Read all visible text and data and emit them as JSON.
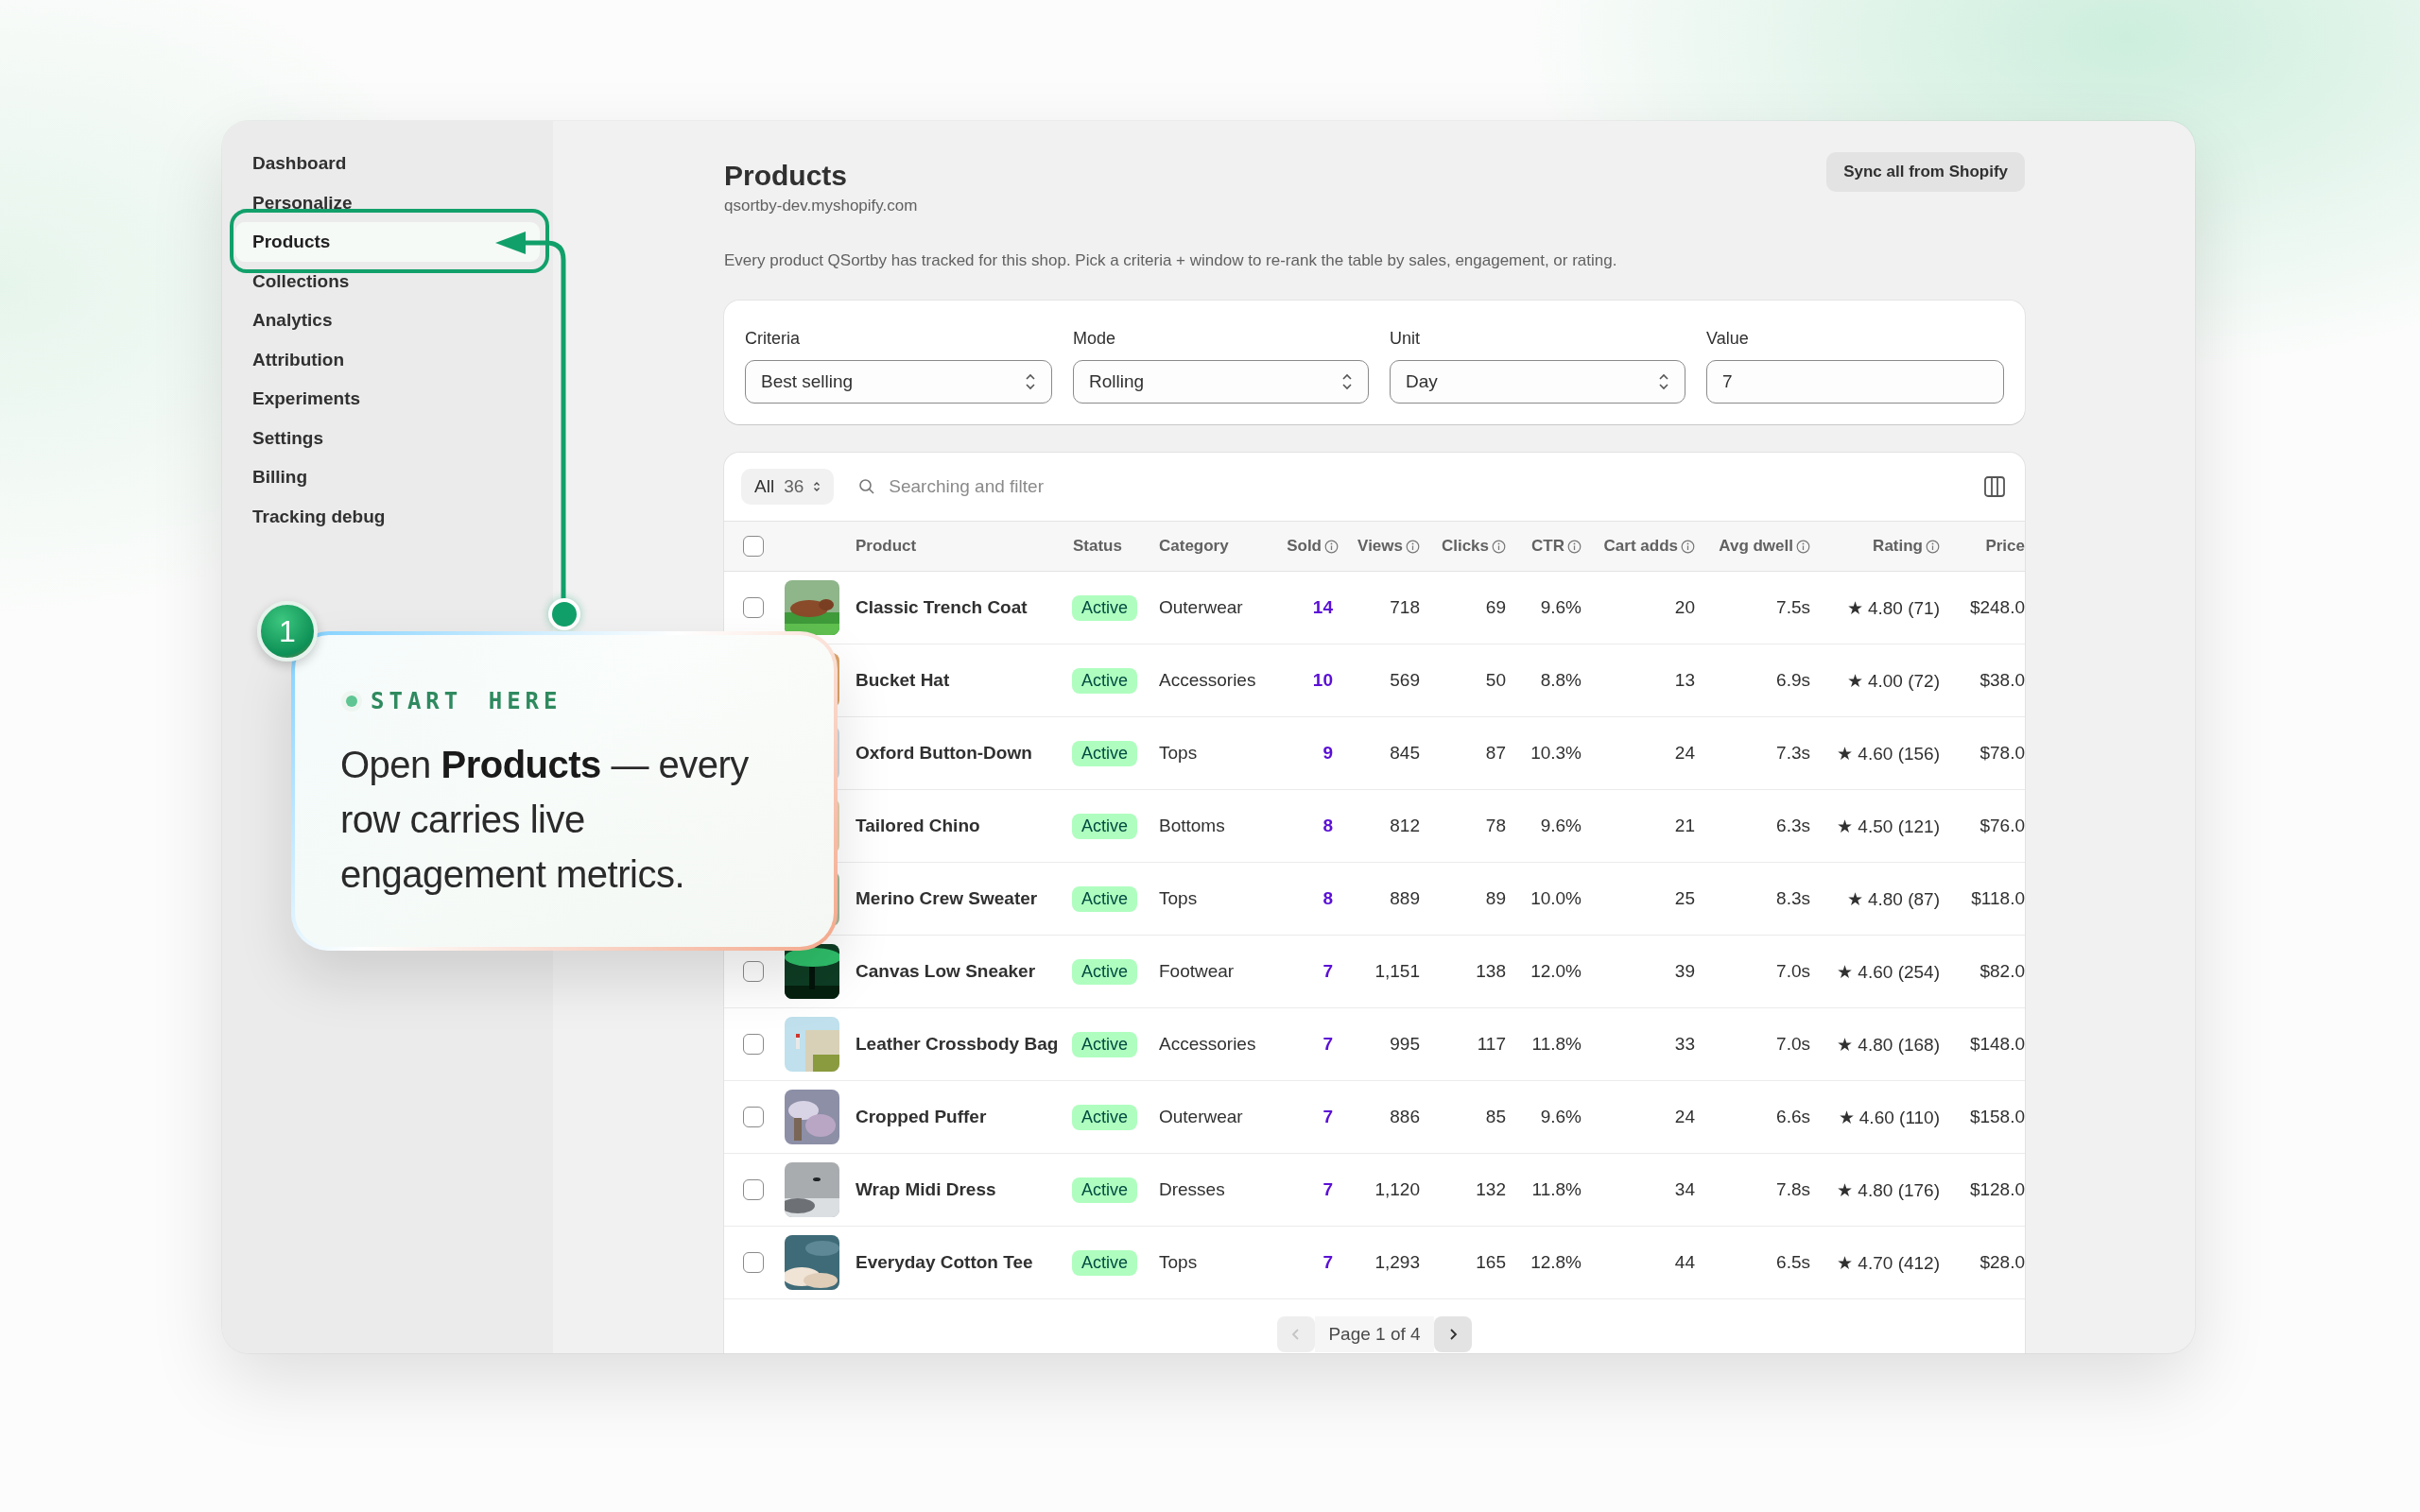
{
  "sidebar": {
    "items": [
      {
        "label": "Dashboard",
        "selected": false
      },
      {
        "label": "Personalize",
        "selected": false
      },
      {
        "label": "Products",
        "selected": true
      },
      {
        "label": "Collections",
        "selected": false
      },
      {
        "label": "Analytics",
        "selected": false
      },
      {
        "label": "Attribution",
        "selected": false
      },
      {
        "label": "Experiments",
        "selected": false
      },
      {
        "label": "Settings",
        "selected": false
      },
      {
        "label": "Billing",
        "selected": false
      },
      {
        "label": "Tracking debug",
        "selected": false
      }
    ]
  },
  "header": {
    "title": "Products",
    "shop": "qsortby-dev.myshopify.com",
    "sync_button": "Sync all from Shopify",
    "description": "Every product QSortby has tracked for this shop. Pick a criteria + window to re-rank the table by sales, engagement, or rating."
  },
  "filters": [
    {
      "label": "Criteria",
      "kind": "select",
      "value": "Best selling"
    },
    {
      "label": "Mode",
      "kind": "select",
      "value": "Rolling"
    },
    {
      "label": "Unit",
      "kind": "select",
      "value": "Day"
    },
    {
      "label": "Value",
      "kind": "input",
      "value": "7"
    }
  ],
  "table": {
    "tab": {
      "label": "All",
      "count": "36"
    },
    "select_all_checked": false,
    "search": {
      "placeholder": "Searching and filter"
    },
    "columns": [
      {
        "label": "Product",
        "info": false
      },
      {
        "label": "Status",
        "info": false
      },
      {
        "label": "Category",
        "info": false
      },
      {
        "label": "Sold",
        "info": true
      },
      {
        "label": "Views",
        "info": true
      },
      {
        "label": "Clicks",
        "info": true
      },
      {
        "label": "CTR",
        "info": true
      },
      {
        "label": "Cart adds",
        "info": true
      },
      {
        "label": "Avg dwell",
        "info": true
      },
      {
        "label": "Rating",
        "info": true
      },
      {
        "label": "Price",
        "info": false
      }
    ],
    "rows": [
      {
        "checked": false,
        "product": "Classic Trench Coat",
        "status": "Active",
        "category": "Outerwear",
        "sold": "14",
        "views": "718",
        "clicks": "69",
        "ctr": "9.6%",
        "cart_adds": "20",
        "avg_dwell": "7.5s",
        "rating": "★ 4.80 (71)",
        "price": "$248.0"
      },
      {
        "product": "Bucket Hat",
        "status": "Active",
        "category": "Accessories",
        "sold": "10",
        "views": "569",
        "clicks": "50",
        "ctr": "8.8%",
        "cart_adds": "13",
        "avg_dwell": "6.9s",
        "rating": "★ 4.00 (72)",
        "price": "$38.0"
      },
      {
        "product": "Oxford Button-Down",
        "status": "Active",
        "category": "Tops",
        "sold": "9",
        "views": "845",
        "clicks": "87",
        "ctr": "10.3%",
        "cart_adds": "24",
        "avg_dwell": "7.3s",
        "rating": "★ 4.60 (156)",
        "price": "$78.0"
      },
      {
        "product": "Tailored Chino",
        "status": "Active",
        "category": "Bottoms",
        "sold": "8",
        "views": "812",
        "clicks": "78",
        "ctr": "9.6%",
        "cart_adds": "21",
        "avg_dwell": "6.3s",
        "rating": "★ 4.50 (121)",
        "price": "$76.0"
      },
      {
        "product": "Merino Crew Sweater",
        "status": "Active",
        "category": "Tops",
        "sold": "8",
        "views": "889",
        "clicks": "89",
        "ctr": "10.0%",
        "cart_adds": "25",
        "avg_dwell": "8.3s",
        "rating": "★ 4.80 (87)",
        "price": "$118.0"
      },
      {
        "checked": false,
        "product": "Canvas Low Sneaker",
        "status": "Active",
        "category": "Footwear",
        "sold": "7",
        "views": "1,151",
        "clicks": "138",
        "ctr": "12.0%",
        "cart_adds": "39",
        "avg_dwell": "7.0s",
        "rating": "★ 4.60 (254)",
        "price": "$82.0"
      },
      {
        "checked": false,
        "product": "Leather Crossbody Bag",
        "status": "Active",
        "category": "Accessories",
        "sold": "7",
        "views": "995",
        "clicks": "117",
        "ctr": "11.8%",
        "cart_adds": "33",
        "avg_dwell": "7.0s",
        "rating": "★ 4.80 (168)",
        "price": "$148.0"
      },
      {
        "checked": false,
        "product": "Cropped Puffer",
        "status": "Active",
        "category": "Outerwear",
        "sold": "7",
        "views": "886",
        "clicks": "85",
        "ctr": "9.6%",
        "cart_adds": "24",
        "avg_dwell": "6.6s",
        "rating": "★ 4.60 (110)",
        "price": "$158.0"
      },
      {
        "checked": false,
        "product": "Wrap Midi Dress",
        "status": "Active",
        "category": "Dresses",
        "sold": "7",
        "views": "1,120",
        "clicks": "132",
        "ctr": "11.8%",
        "cart_adds": "34",
        "avg_dwell": "7.8s",
        "rating": "★ 4.80 (176)",
        "price": "$128.0"
      },
      {
        "checked": false,
        "product": "Everyday Cotton Tee",
        "status": "Active",
        "category": "Tops",
        "sold": "7",
        "views": "1,293",
        "clicks": "165",
        "ctr": "12.8%",
        "cart_adds": "44",
        "avg_dwell": "6.5s",
        "rating": "★ 4.70 (412)",
        "price": "$28.0"
      }
    ],
    "pagination": {
      "label": "Page 1 of 4",
      "prev_disabled": true,
      "next_disabled": false
    }
  },
  "callout": {
    "step": "1",
    "eyebrow": "START HERE",
    "text": "Open **Products** — every row carries live engagement metrics."
  }
}
